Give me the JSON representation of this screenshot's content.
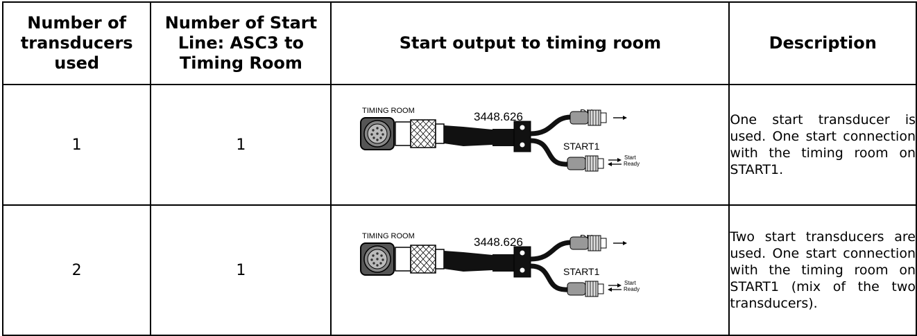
{
  "table": {
    "headers": [
      "Number of transducers used",
      "Number of Start Line: ASC3 to Timing Room",
      "Start output to timing room",
      "Description"
    ],
    "rows": [
      {
        "transducers": "1",
        "start_lines": "1",
        "diagram": {
          "timing_room": "TIMING ROOM",
          "part_number": "3448.626",
          "dh": "DH",
          "start1": "START1",
          "start": "Start",
          "ready": "Ready"
        },
        "description": "One start transducer is used. One start connection with the timing room on START1."
      },
      {
        "transducers": "2",
        "start_lines": "1",
        "diagram": {
          "timing_room": "TIMING ROOM",
          "part_number": "3448.626",
          "dh": "DH",
          "start1": "START1",
          "start": "Start",
          "ready": "Ready"
        },
        "description": "Two start transducers are used. One start connection with the timing room on START1 (mix of the two transducers)."
      }
    ]
  }
}
